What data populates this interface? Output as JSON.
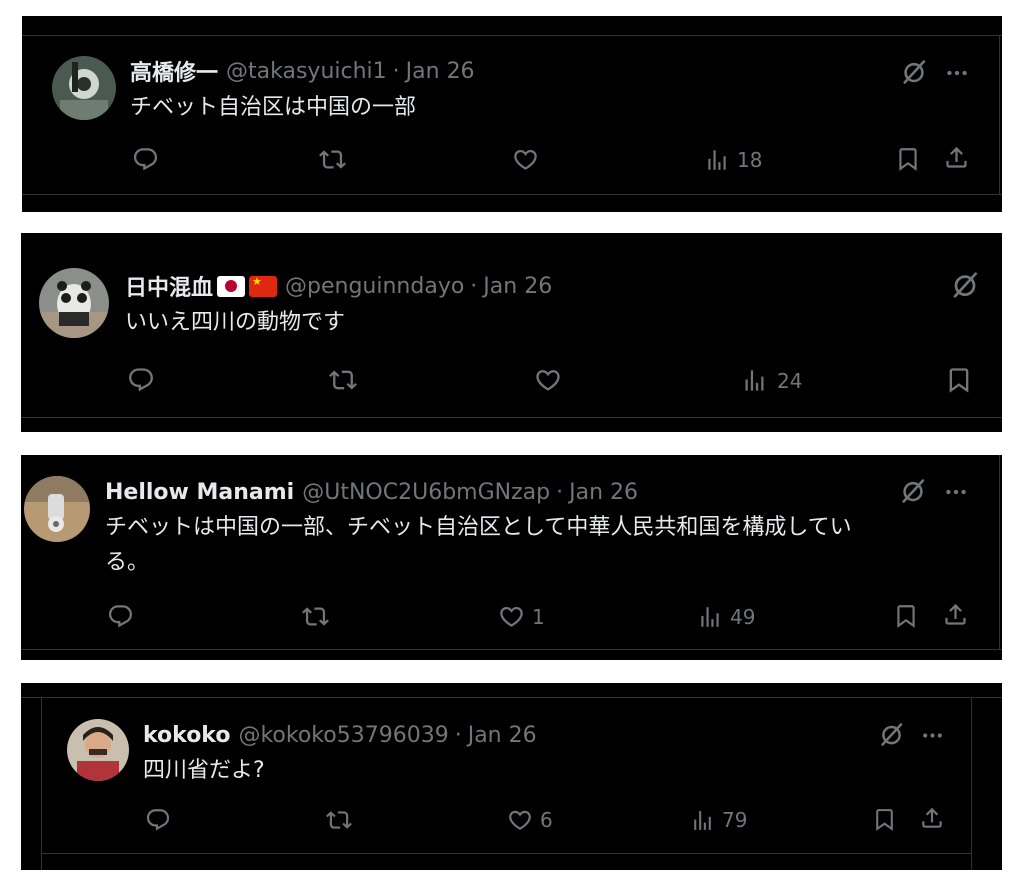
{
  "colors": {
    "background": "#000000",
    "text": "#e7e9ea",
    "secondary": "#71767b",
    "border": "#2f3336"
  },
  "posts": [
    {
      "display_name": "高橋修一",
      "handle": "@takasyuichi1",
      "date": "Jan 26",
      "text": "チベット自治区は中国の一部",
      "likes": "",
      "views": "18",
      "icons": [
        "reply-icon",
        "repost-icon",
        "like-icon",
        "views-icon",
        "bookmark-icon",
        "share-icon",
        "grok-icon",
        "more-icon"
      ]
    },
    {
      "display_name": "日中混血",
      "flags": [
        "japan-flag",
        "china-flag"
      ],
      "handle": "@penguinndayo",
      "date": "Jan 26",
      "text": "いいえ四川の動物です",
      "likes": "",
      "views": "24",
      "icons": [
        "reply-icon",
        "repost-icon",
        "like-icon",
        "views-icon",
        "bookmark-icon",
        "grok-icon"
      ]
    },
    {
      "display_name": "Hellow Manami",
      "handle": "@UtNOC2U6bmGNzap",
      "date": "Jan 26",
      "text_line1": "チベットは中国の一部、チベット自治区として中華人民共和国を構成してい",
      "text_line2": "る。",
      "likes": "1",
      "views": "49",
      "icons": [
        "reply-icon",
        "repost-icon",
        "like-icon",
        "views-icon",
        "bookmark-icon",
        "share-icon",
        "grok-icon",
        "more-icon"
      ]
    },
    {
      "display_name": "kokoko",
      "handle": "@kokoko53796039",
      "date": "Jan 26",
      "text": "四川省だよ?",
      "likes": "6",
      "views": "79",
      "icons": [
        "reply-icon",
        "repost-icon",
        "like-icon",
        "views-icon",
        "bookmark-icon",
        "share-icon",
        "grok-icon",
        "more-icon"
      ]
    }
  ],
  "separator": "·"
}
